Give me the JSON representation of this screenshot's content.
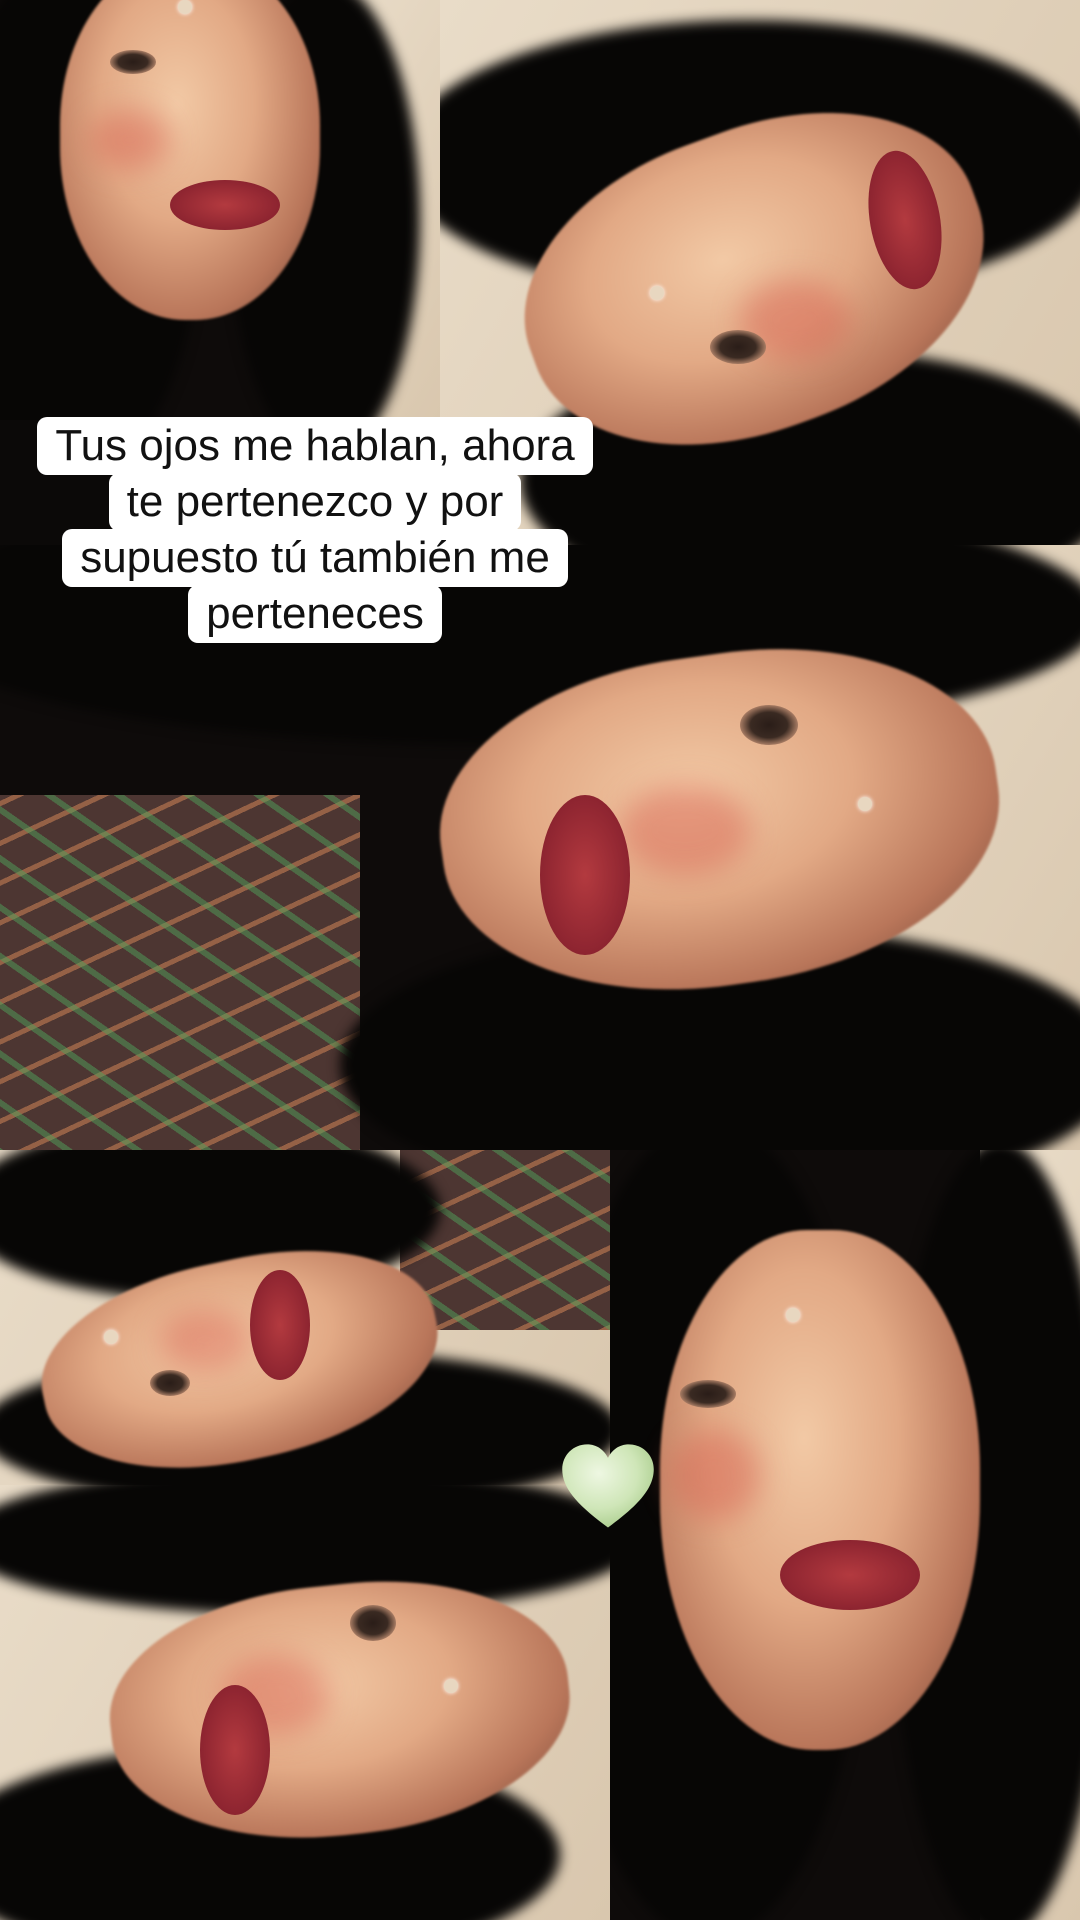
{
  "caption": {
    "lines": [
      "Tus ojos me hablan, ahora",
      "te pertenezco y por",
      "supuesto tú también me",
      "perteneces"
    ]
  },
  "sticker": {
    "icon": "green-heart-icon",
    "color": "#cfe6b8"
  },
  "collage": {
    "photos": [
      "selfie-top-left",
      "selfie-top-right",
      "selfie-center-wide",
      "selfie-middle-left",
      "selfie-bottom-right",
      "selfie-bottom-left"
    ]
  }
}
